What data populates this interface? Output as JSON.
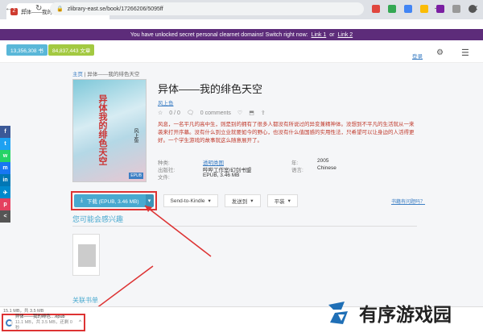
{
  "browser": {
    "tab_title": "异体——我的绯色天空 | 风上鱼 | Z-Li",
    "tab_favicon": "Z",
    "url": "zlibrary-east.se/book/17266206/5095ff",
    "new_tab": "+",
    "nav_icons": [
      "back-arrow-icon",
      "forward-arrow-icon",
      "reload-icon"
    ]
  },
  "notice": {
    "text": "You have unlocked secret personal clearnet domains!  Switch right now:",
    "link1": "Link 1",
    "or": "or",
    "link2": "Link 2"
  },
  "header": {
    "stat_books": "13,356,308 书",
    "stat_articles": "84,837,443 文章",
    "login": "登录"
  },
  "breadcrumb": {
    "home": "主页",
    "sep": "|",
    "current": "异体——我的绯色天空"
  },
  "cover": {
    "title": "异体我的绯色天空",
    "author": "风上鱼",
    "badge": "EPUB"
  },
  "book": {
    "title": "异体——我的绯色天空",
    "author": "风上鱼",
    "rating": "0 / 0",
    "comments": "0 comments",
    "description": "风息，一名平凡的高中生，则是别的拥有了很多人都没有所说过的异变兼精神体。没想到不平凡的生活就从一来袭来打开序幕。没有什么到立业就要如今的野心，也没有什么值国感的实用性法，只希望可以让身边的人活得更好。一个学生游戏的故事就这么随意展开了。",
    "meta": [
      {
        "k1": "种类:",
        "v1": "透明类图",
        "link": true,
        "k2": "年:",
        "v2": "2005"
      },
      {
        "k1": "出版社:",
        "v1": "哔哔工作室/幻剑书盟",
        "link": false,
        "k2": "语言:",
        "v2": "Chinese"
      },
      {
        "k1": "文件:",
        "v1": "EPUB, 3.46 MB",
        "link": false,
        "k2": "",
        "v2": ""
      }
    ]
  },
  "actions": {
    "download": "下载 (EPUB, 3.46 MB)",
    "send_kindle": "Send-to-Kindle",
    "send_to": "发送到",
    "read": "平装",
    "report": "书籍有问题吗？"
  },
  "sections": {
    "also_like": "您可能会感兴趣",
    "related": "关联书单"
  },
  "share_colors": [
    "#3b5998",
    "#1da1f2",
    "#25d366",
    "#1877f2",
    "#0077b5",
    "#0088cc",
    "#e4405f",
    "#555555"
  ],
  "share_labels": [
    "f",
    "t",
    "w",
    "m",
    "in",
    "✈",
    "p",
    "<"
  ],
  "download_bar": {
    "progress": "15.1 MB，共 3.5 MB",
    "file": "异体——我的绯色…epub",
    "status": "11.1 MB，共 3.5 MB，还剩 0 秒",
    "caret": "^"
  },
  "watermark": {
    "text": "有序游戏园"
  }
}
